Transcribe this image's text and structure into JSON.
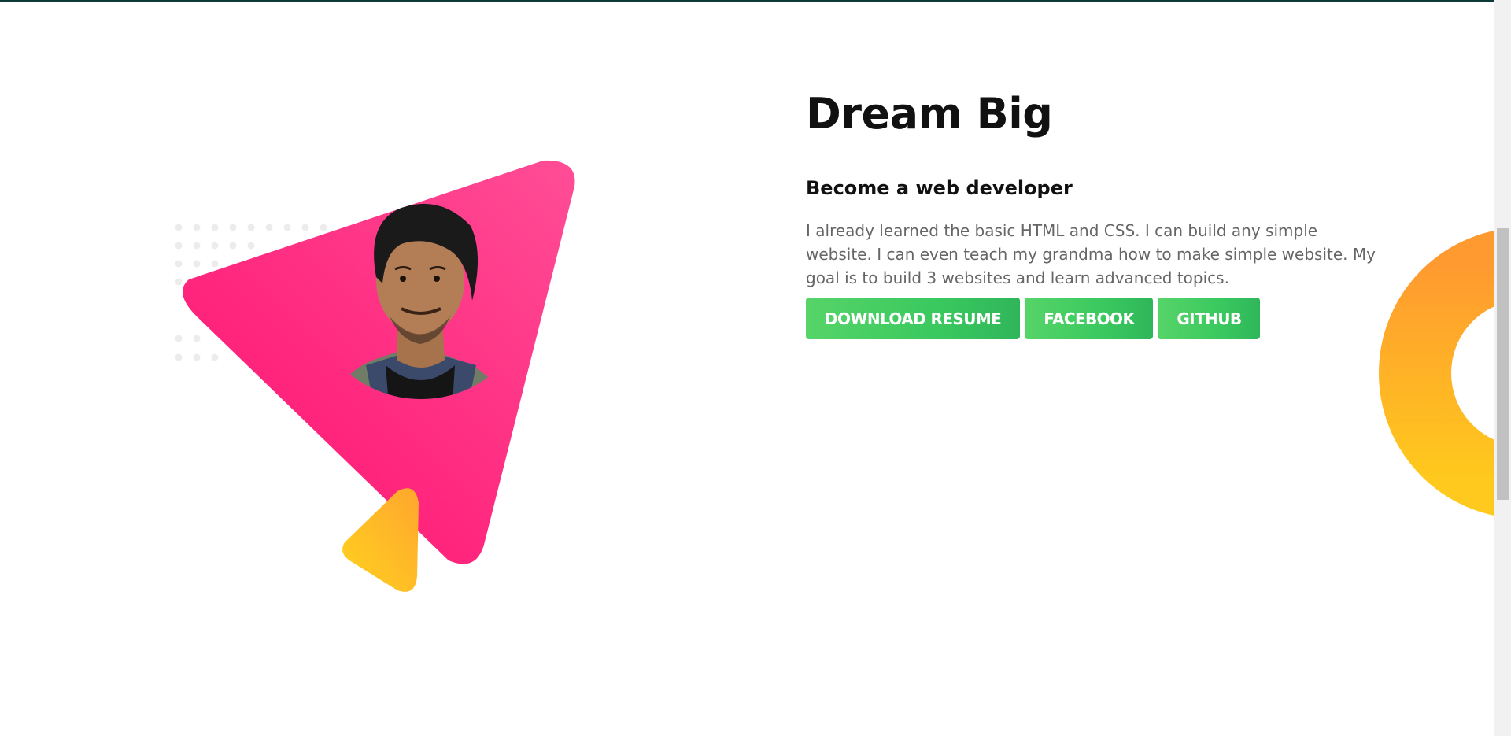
{
  "hero": {
    "title": "Dream Big",
    "subtitle": "Become a web developer",
    "description": "I already learned the basic HTML and CSS. I can build any simple website. I can even teach my grandma how to make simple website. My goal is to build 3 websites and learn advanced topics."
  },
  "buttons": {
    "download_resume": "DOWNLOAD RESUME",
    "facebook": "FACEBOOK",
    "github": "GITHUB"
  },
  "colors": {
    "primary_green": "#3ac95f",
    "pink": "#ff1a72",
    "yellow": "#ffc61a",
    "orange": "#ff9b2f",
    "page_background": "#ffffff"
  },
  "icons": {
    "portrait": "person-photo",
    "decorations": [
      "dot-grid",
      "pink-triangle",
      "yellow-triangle",
      "orange-donut"
    ]
  }
}
